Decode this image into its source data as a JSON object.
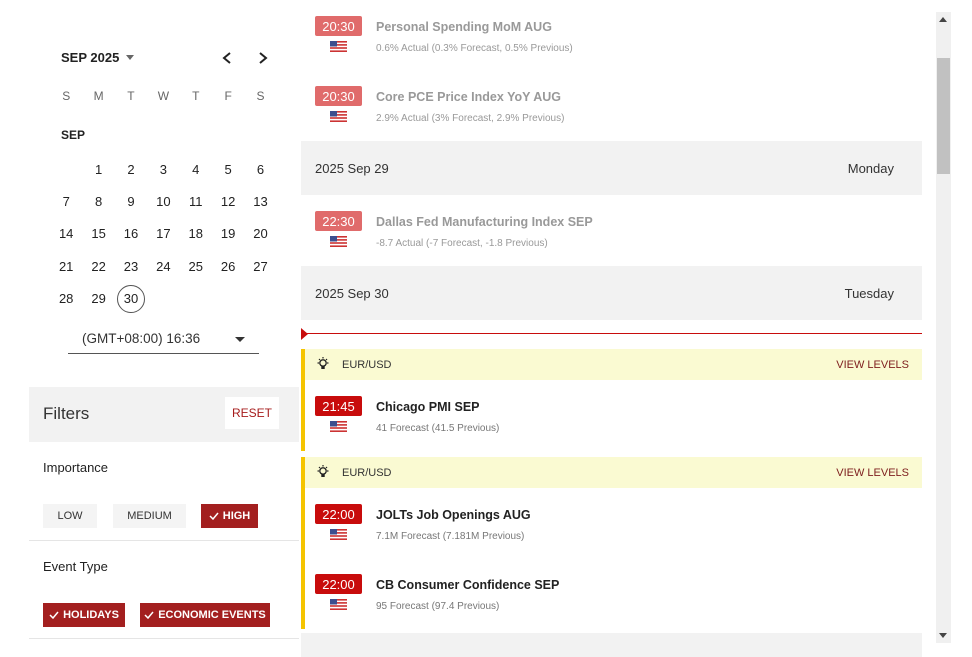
{
  "calendar": {
    "month_title": "SEP 2025",
    "weekdays": [
      "S",
      "M",
      "T",
      "W",
      "T",
      "F",
      "S"
    ],
    "month_label": "SEP",
    "days": [
      "",
      "1",
      "2",
      "3",
      "4",
      "5",
      "6",
      "7",
      "8",
      "9",
      "10",
      "11",
      "12",
      "13",
      "14",
      "15",
      "16",
      "17",
      "18",
      "19",
      "20",
      "21",
      "22",
      "23",
      "24",
      "25",
      "26",
      "27",
      "28",
      "29",
      "30"
    ],
    "today": "30",
    "timezone": "(GMT+08:00) 16:36"
  },
  "filters": {
    "title": "Filters",
    "reset_label": "RESET",
    "importance_label": "Importance",
    "importance": [
      {
        "label": "LOW",
        "active": false
      },
      {
        "label": "MEDIUM",
        "active": false
      },
      {
        "label": "HIGH",
        "active": true
      }
    ],
    "event_type_label": "Event Type",
    "event_types": [
      {
        "label": "HOLIDAYS",
        "active": true
      },
      {
        "label": "ECONOMIC EVENTS",
        "active": true
      }
    ]
  },
  "feed": {
    "past_events": [
      {
        "time": "20:30",
        "title": "Personal Spending MoM AUG",
        "detail": "0.6% Actual (0.3% Forecast, 0.5% Previous)"
      },
      {
        "time": "20:30",
        "title": "Core PCE Price Index YoY AUG",
        "detail": "2.9% Actual (3% Forecast, 2.9% Previous)"
      }
    ],
    "date_rows": [
      {
        "date": "2025 Sep 29",
        "weekday": "Monday"
      },
      {
        "date": "2025 Sep 30",
        "weekday": "Tuesday"
      }
    ],
    "sep29_event": {
      "time": "22:30",
      "title": "Dallas Fed Manufacturing Index SEP",
      "detail": "-8.7 Actual (-7 Forecast, -1.8 Previous)"
    },
    "groups": [
      {
        "pair": "EUR/USD",
        "view_levels": "VIEW LEVELS",
        "events": [
          {
            "time": "21:45",
            "title": "Chicago PMI SEP",
            "detail": "41 Forecast (41.5 Previous)"
          }
        ]
      },
      {
        "pair": "EUR/USD",
        "view_levels": "VIEW LEVELS",
        "events": [
          {
            "time": "22:00",
            "title": "JOLTs Job Openings AUG",
            "detail": "7.1M Forecast (7.181M Previous)"
          },
          {
            "time": "22:00",
            "title": "CB Consumer Confidence SEP",
            "detail": "95 Forecast (97.4 Previous)"
          }
        ]
      }
    ]
  },
  "colors": {
    "accent": "#a31f1f",
    "now": "#c80c0c",
    "past_badge": "#e06b6b",
    "highlight": "#f5c400"
  }
}
